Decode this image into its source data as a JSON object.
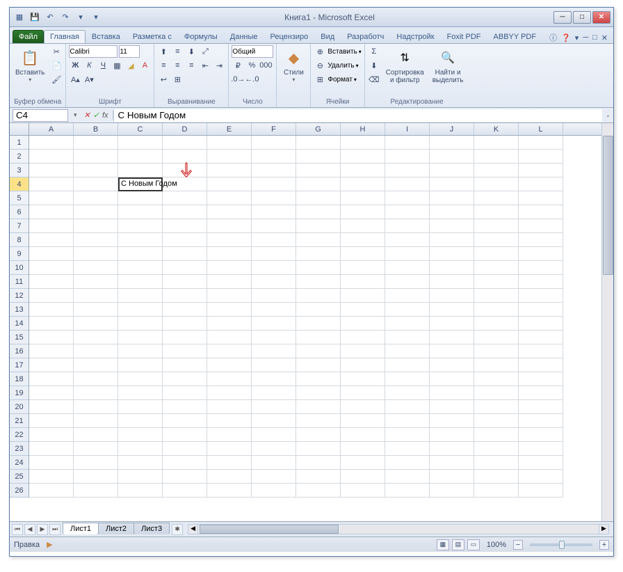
{
  "titlebar": {
    "title": "Книга1 - Microsoft Excel"
  },
  "qat": {
    "save": "💾",
    "undo": "↶",
    "redo": "↷"
  },
  "tabs": {
    "file": "Файл",
    "home": "Главная",
    "insert": "Вставка",
    "layout": "Разметка с",
    "formulas": "Формулы",
    "data": "Данные",
    "review": "Рецензиро",
    "view": "Вид",
    "dev": "Разработч",
    "addins": "Надстройк",
    "foxit": "Foxit PDF",
    "abbyy": "ABBYY PDF"
  },
  "ribbon": {
    "clipboard": {
      "label": "Буфер обмена",
      "paste": "Вставить"
    },
    "font": {
      "label": "Шрифт",
      "name": "Calibri",
      "size": "11"
    },
    "align": {
      "label": "Выравнивание"
    },
    "number": {
      "label": "Число",
      "format": "Общий"
    },
    "styles": {
      "label": "",
      "styles_btn": "Стили"
    },
    "cells": {
      "label": "Ячейки",
      "insert": "Вставить",
      "delete": "Удалить",
      "format": "Формат"
    },
    "editing": {
      "label": "Редактирование",
      "sort": "Сортировка\nи фильтр",
      "find": "Найти и\nвыделить"
    }
  },
  "formula_bar": {
    "name_box": "C4",
    "formula": "С Новым Годом"
  },
  "grid": {
    "cols": [
      "A",
      "B",
      "C",
      "D",
      "E",
      "F",
      "G",
      "H",
      "I",
      "J",
      "K",
      "L"
    ],
    "rows": 26,
    "active_cell": {
      "row": 4,
      "col": "C",
      "value": "С Новым Годом"
    }
  },
  "sheets": {
    "tabs": [
      "Лист1",
      "Лист2",
      "Лист3"
    ],
    "active": 0
  },
  "status": {
    "mode": "Правка",
    "zoom": "100%"
  }
}
